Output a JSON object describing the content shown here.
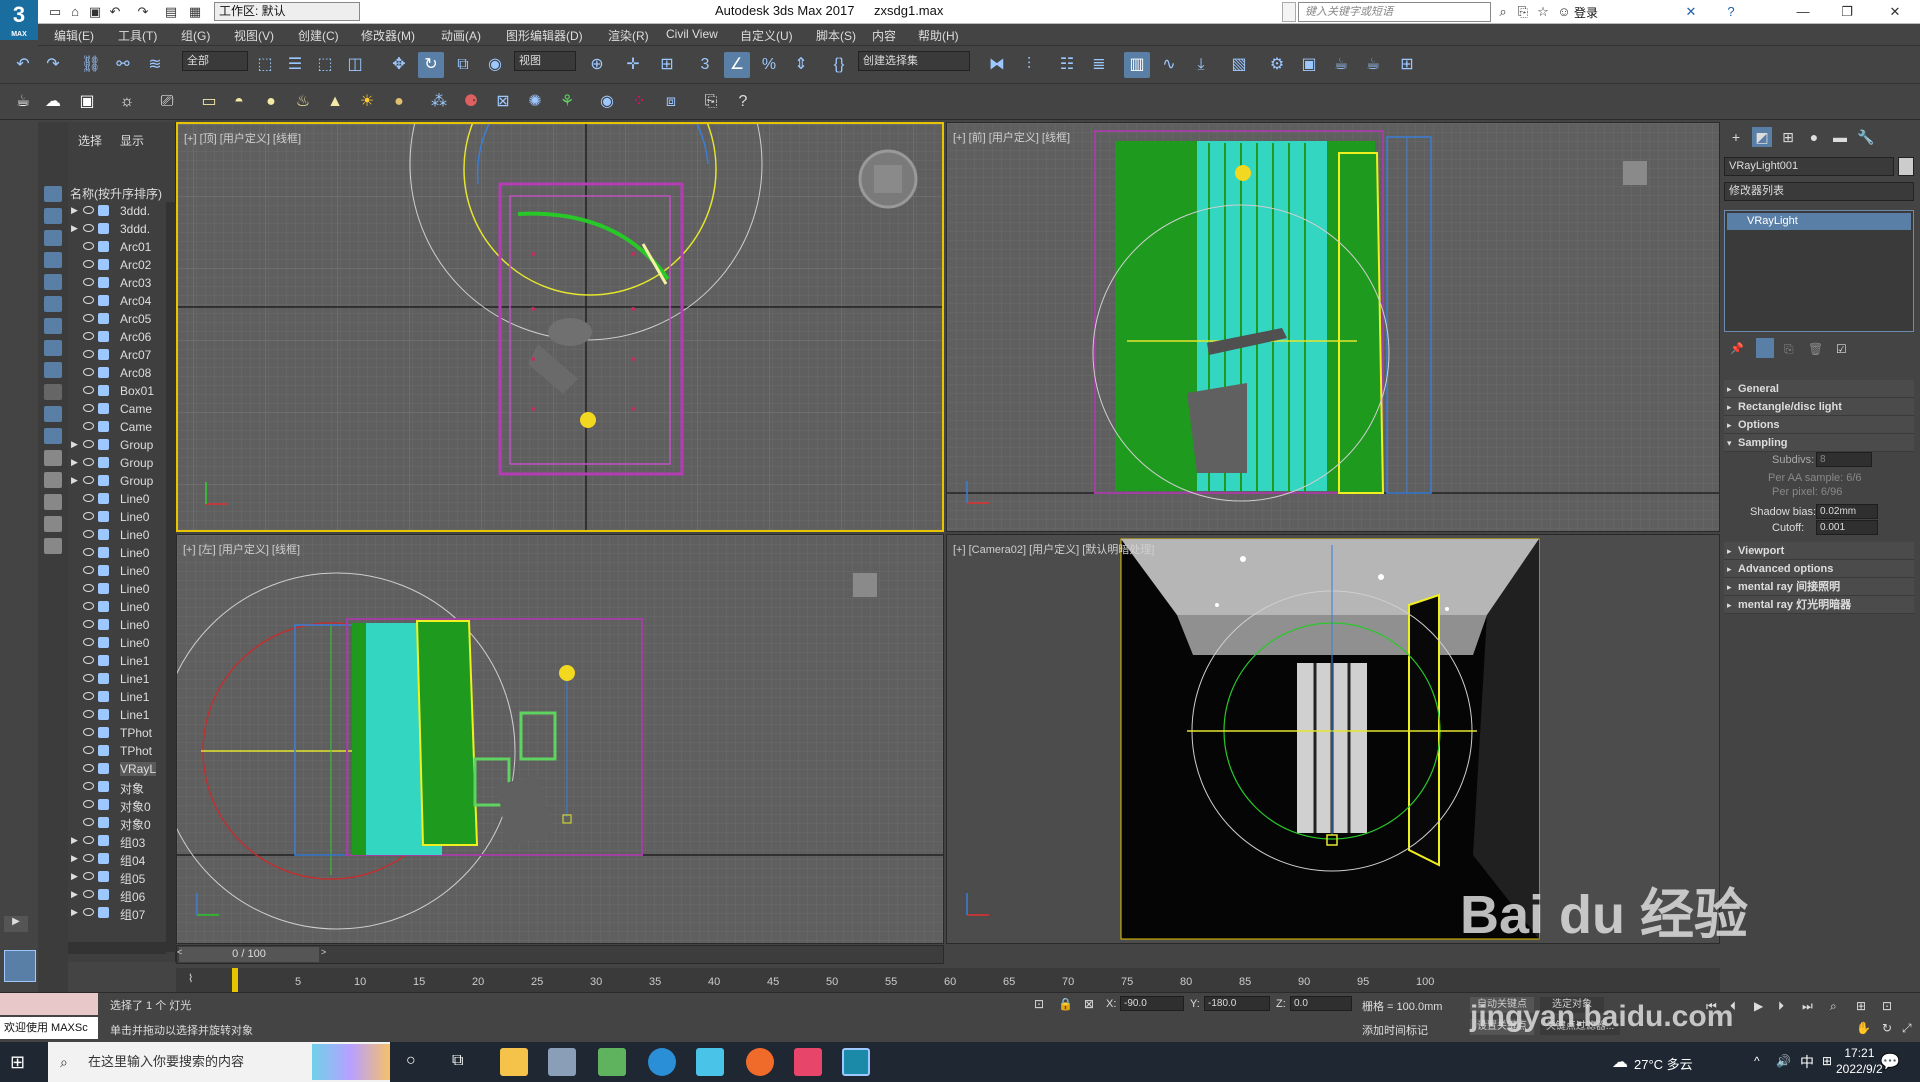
{
  "titlebar": {
    "logo_text": "3",
    "logo_sub": "MAX",
    "workspace": "工作区: 默认",
    "app_title": "Autodesk 3ds Max 2017",
    "file_name": "zxsdg1.max",
    "search_placeholder": "键入关键字或短语",
    "login": "登录"
  },
  "menubar": [
    "编辑(E)",
    "工具(T)",
    "组(G)",
    "视图(V)",
    "创建(C)",
    "修改器(M)",
    "动画(A)",
    "图形编辑器(D)",
    "渲染(R)",
    "Civil View",
    "自定义(U)",
    "脚本(S)",
    "内容",
    "帮助(H)"
  ],
  "toolbar1": {
    "filter_dropdown": "全部",
    "view_dropdown": "视图",
    "selection_set_dropdown": "创建选择集"
  },
  "scene_explorer": {
    "tabs": [
      "选择",
      "显示"
    ],
    "header": "名称(按升序排序)",
    "rows": [
      {
        "name": "3ddd.",
        "expand": true,
        "type": "group"
      },
      {
        "name": "3ddd.",
        "expand": true,
        "type": "group"
      },
      {
        "name": "Arc01",
        "expand": false,
        "type": "shape"
      },
      {
        "name": "Arc02",
        "expand": false,
        "type": "shape"
      },
      {
        "name": "Arc03",
        "expand": false,
        "type": "shape"
      },
      {
        "name": "Arc04",
        "expand": false,
        "type": "shape"
      },
      {
        "name": "Arc05",
        "expand": false,
        "type": "shape"
      },
      {
        "name": "Arc06",
        "expand": false,
        "type": "shape"
      },
      {
        "name": "Arc07",
        "expand": false,
        "type": "shape"
      },
      {
        "name": "Arc08",
        "expand": false,
        "type": "shape"
      },
      {
        "name": "Box01",
        "expand": false,
        "type": "geometry"
      },
      {
        "name": "Came",
        "expand": false,
        "type": "camera"
      },
      {
        "name": "Came",
        "expand": false,
        "type": "camera"
      },
      {
        "name": "Group",
        "expand": true,
        "type": "group"
      },
      {
        "name": "Group",
        "expand": true,
        "type": "group"
      },
      {
        "name": "Group",
        "expand": true,
        "type": "group"
      },
      {
        "name": "Line0",
        "expand": false,
        "type": "shape"
      },
      {
        "name": "Line0",
        "expand": false,
        "type": "shape"
      },
      {
        "name": "Line0",
        "expand": false,
        "type": "shape"
      },
      {
        "name": "Line0",
        "expand": false,
        "type": "shape"
      },
      {
        "name": "Line0",
        "expand": false,
        "type": "shape"
      },
      {
        "name": "Line0",
        "expand": false,
        "type": "shape"
      },
      {
        "name": "Line0",
        "expand": false,
        "type": "shape"
      },
      {
        "name": "Line0",
        "expand": false,
        "type": "shape"
      },
      {
        "name": "Line0",
        "expand": false,
        "type": "shape"
      },
      {
        "name": "Line1",
        "expand": false,
        "type": "shape"
      },
      {
        "name": "Line1",
        "expand": false,
        "type": "shape"
      },
      {
        "name": "Line1",
        "expand": false,
        "type": "shape"
      },
      {
        "name": "Line1",
        "expand": false,
        "type": "shape"
      },
      {
        "name": "TPhot",
        "expand": false,
        "type": "light"
      },
      {
        "name": "TPhot",
        "expand": false,
        "type": "light"
      },
      {
        "name": "VRayL",
        "expand": false,
        "type": "light",
        "selected": true
      },
      {
        "name": "对象",
        "expand": false,
        "type": "geometry"
      },
      {
        "name": "对象0",
        "expand": false,
        "type": "geometry"
      },
      {
        "name": "对象0",
        "expand": false,
        "type": "geometry"
      },
      {
        "name": "组03",
        "expand": true,
        "type": "group"
      },
      {
        "name": "组04",
        "expand": true,
        "type": "group"
      },
      {
        "name": "组05",
        "expand": true,
        "type": "group"
      },
      {
        "name": "组06",
        "expand": true,
        "type": "group"
      },
      {
        "name": "组07",
        "expand": true,
        "type": "group"
      }
    ]
  },
  "viewports": {
    "top": "[+] [顶] [用户定义] [线框]",
    "front": "[+] [前] [用户定义] [线框]",
    "left": "[+] [左] [用户定义] [线框]",
    "camera": "[+] [Camera02] [用户定义] [默认明暗处理]"
  },
  "command_panel": {
    "object_name": "VRayLight001",
    "modifier_list": "修改器列表",
    "stack_item": "VRayLight",
    "rollouts": [
      {
        "label": "General",
        "open": false
      },
      {
        "label": "Rectangle/disc light",
        "open": false
      },
      {
        "label": "Options",
        "open": false
      },
      {
        "label": "Sampling",
        "open": true
      }
    ],
    "sampling": {
      "subdivs_label": "Subdivs:",
      "subdivs_value": "8",
      "aa_label": "Per AA sample: 6/6",
      "pixel_label": "Per pixel: 6/96",
      "shadow_bias_label": "Shadow bias:",
      "shadow_bias_value": "0.02mm",
      "cutoff_label": "Cutoff:",
      "cutoff_value": "0.001"
    },
    "rollouts2": [
      {
        "label": "Viewport"
      },
      {
        "label": "Advanced options"
      },
      {
        "label": "mental ray 间接照明"
      },
      {
        "label": "mental ray 灯光明暗器"
      }
    ]
  },
  "timeline": {
    "slider_label": "0 / 100",
    "ticks": [
      "0",
      "5",
      "10",
      "15",
      "20",
      "25",
      "30",
      "35",
      "40",
      "45",
      "50",
      "55",
      "60",
      "65",
      "70",
      "75",
      "80",
      "85",
      "90",
      "95",
      "100"
    ]
  },
  "statusbar": {
    "maxscript": "欢迎使用 MAXSc",
    "status1": "选择了 1 个 灯光",
    "status2": "单击并拖动以选择并旋转对象",
    "x_label": "X:",
    "x_value": "-90.0",
    "y_label": "Y:",
    "y_value": "-180.0",
    "z_label": "Z:",
    "z_value": "0.0",
    "grid": "栅格 = 100.0mm",
    "add_time_tag": "添加时间标记",
    "auto_key": "自动关键点",
    "selected_obj": "选定对象",
    "set_key": "设置关键点",
    "key_filter": "关键点过滤器..."
  },
  "taskbar": {
    "search": "在这里输入你要搜索的内容",
    "weather": "27°C 多云",
    "ime": "中",
    "time": "17:21",
    "date": "2022/9/2"
  },
  "watermark": {
    "brand": "Bai  du 经验",
    "url": "jingyan.baidu.com"
  }
}
